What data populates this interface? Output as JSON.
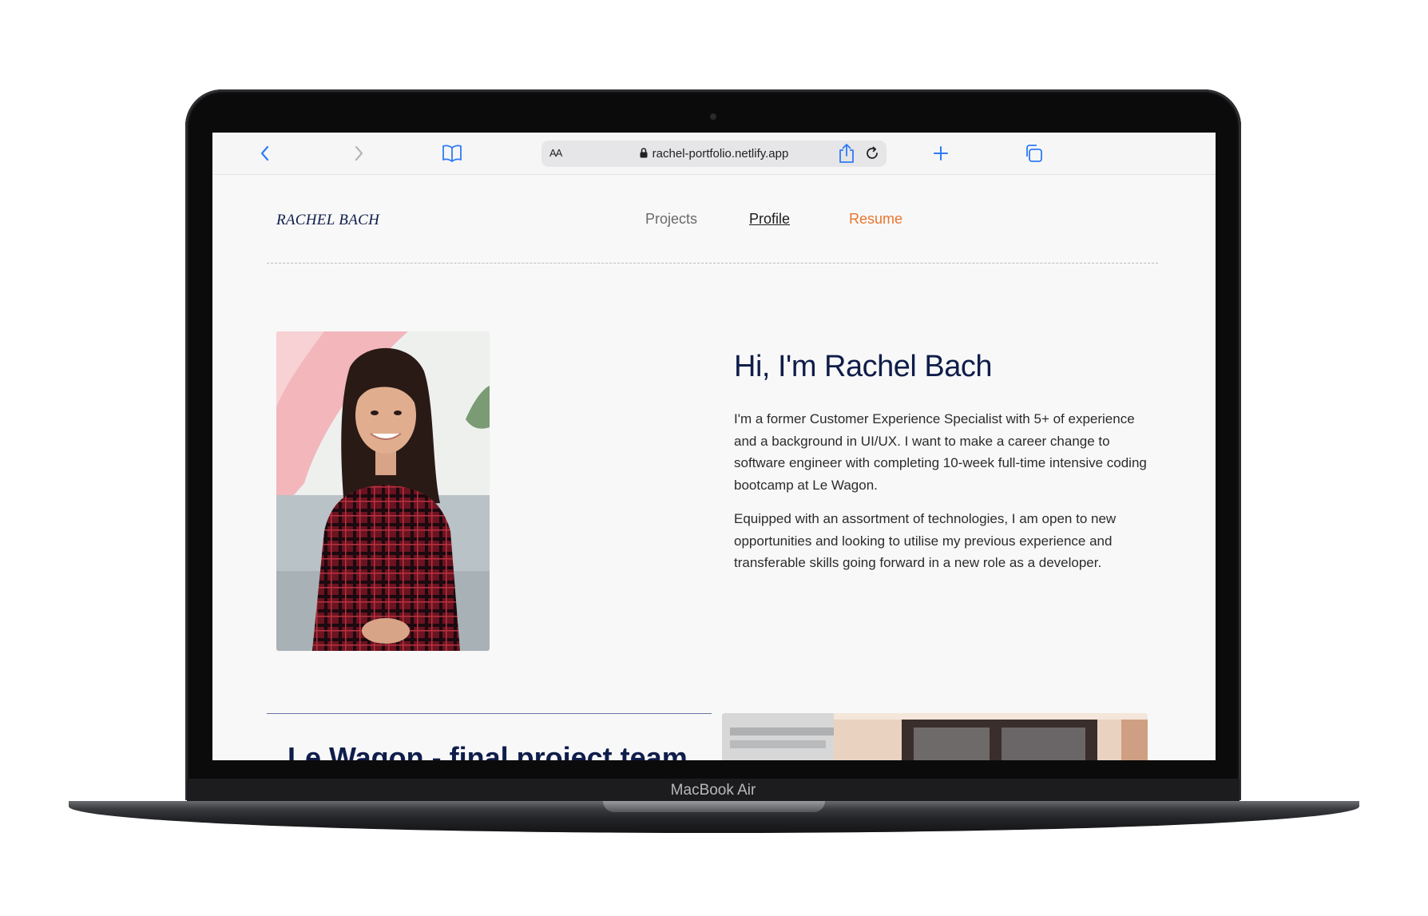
{
  "device": {
    "label": "MacBook Air"
  },
  "browser": {
    "address_bar": {
      "reader_label": "AA",
      "url": "rachel-portfolio.netlify.app"
    },
    "icons": [
      "chevron-left-icon",
      "chevron-right-icon",
      "book-icon",
      "lock-icon",
      "reload-icon",
      "share-icon",
      "plus-icon",
      "tabs-icon"
    ]
  },
  "site": {
    "logo": "RACHEL BACH",
    "nav": {
      "projects": "Projects",
      "profile": "Profile",
      "resume": "Resume"
    },
    "hero": {
      "title": "Hi, I'm Rachel Bach",
      "paragraph_1": "I'm a former Customer Experience Specialist with 5+ of experience and a background in UI/UX. I want to make a career change to software engineer with completing 10-week full-time intensive coding bootcamp at Le Wagon.",
      "paragraph_2": "Equipped with an assortment of technologies, I am open to new opportunities and looking to utilise my previous experience and transferable skills going forward in a new role as a developer."
    },
    "next_section": {
      "title": "Le Wagon - final project team"
    }
  },
  "colors": {
    "navy": "#0f1d4a",
    "accent_orange": "#e8762d",
    "link_blue": "#2f7bf5"
  }
}
